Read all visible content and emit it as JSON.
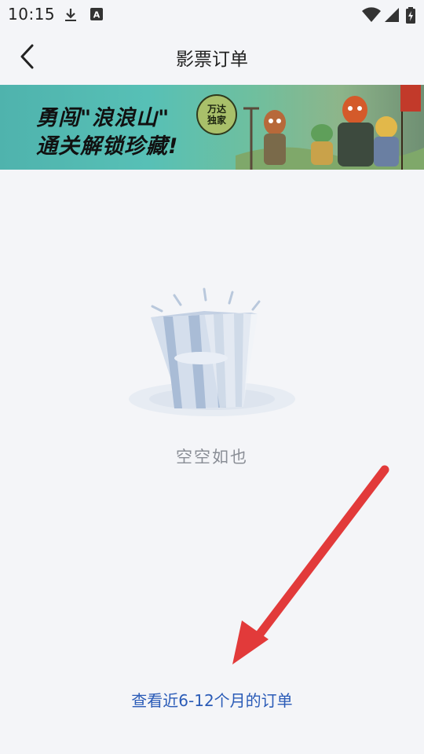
{
  "status_bar": {
    "time": "10:15",
    "icons": [
      "download-icon",
      "text-a-icon",
      "wifi-icon",
      "signal-icon",
      "battery-charging-icon"
    ]
  },
  "nav": {
    "title": "影票订单",
    "back_icon": "chevron-left-icon"
  },
  "banner": {
    "line1": "勇闯\"浪浪山\"",
    "line2": "通关解锁珍藏!",
    "badge_top": "万达",
    "badge_bottom": "独家"
  },
  "empty_state": {
    "icon": "popcorn-bucket-icon",
    "text": "空空如也"
  },
  "footer": {
    "link_text": "查看近6-12个月的订单"
  },
  "colors": {
    "background": "#f4f5f8",
    "link": "#2a5bb7",
    "annotation_arrow": "#e23a3a"
  }
}
